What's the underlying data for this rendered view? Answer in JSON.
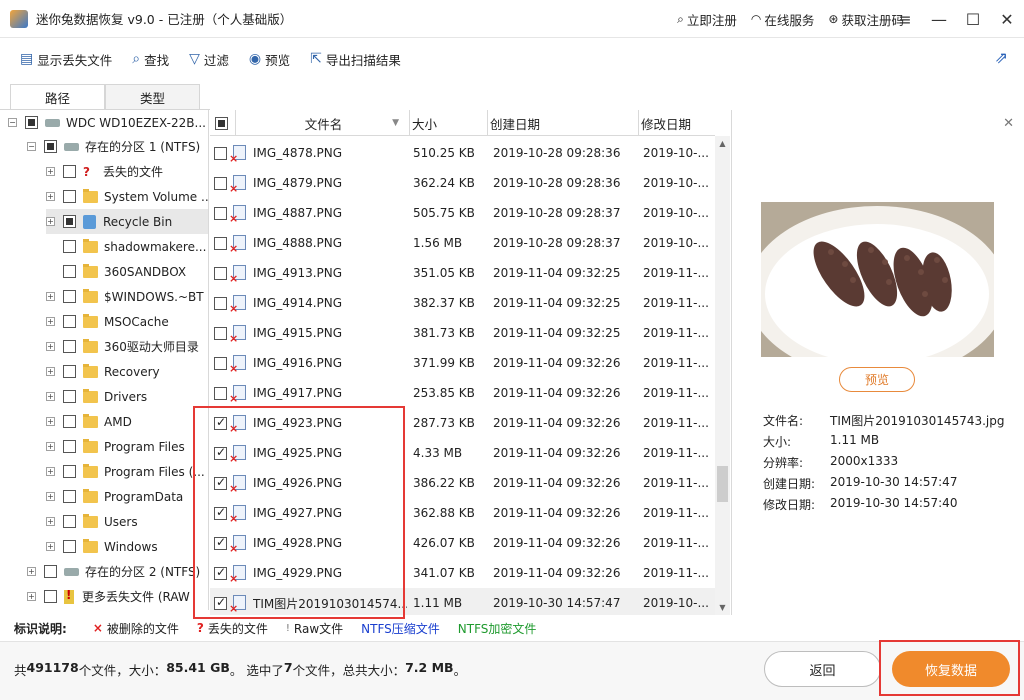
{
  "window": {
    "title": "迷你兔数据恢复 v9.0 - 已注册（个人基础版）",
    "actions": [
      {
        "label": "立即注册",
        "icon": "search-icon"
      },
      {
        "label": "在线服务",
        "icon": "headset-icon"
      },
      {
        "label": "获取注册码",
        "icon": "cart-icon"
      }
    ]
  },
  "toolbar": {
    "show_lost": "显示丢失文件",
    "find": "查找",
    "filter": "过滤",
    "preview": "预览",
    "export": "导出扫描结果"
  },
  "tabs": {
    "path": "路径",
    "type": "类型"
  },
  "tree": {
    "drive": "WDC WD10EZEX-22B...",
    "partition1": "存在的分区 1 (NTFS)",
    "items": [
      "丢失的文件",
      "System Volume ...",
      "Recycle Bin",
      "shadowmakere...",
      "360SANDBOX",
      "$WINDOWS.~BT",
      "MSOCache",
      "360驱动大师目录",
      "Recovery",
      "Drivers",
      "AMD",
      "Program Files",
      "Program Files (...",
      "ProgramData",
      "Users",
      "Windows"
    ],
    "partition2": "存在的分区 2 (NTFS)",
    "more_lost": "更多丢失文件 (RAW"
  },
  "filelist": {
    "headers": {
      "name": "文件名",
      "size": "大小",
      "created": "创建日期",
      "modified": "修改日期"
    },
    "rows": [
      {
        "name": "IMG_4878.PNG",
        "size": "510.25 KB",
        "created": "2019-10-28 09:28:36",
        "modified": "2019-10-...",
        "checked": false
      },
      {
        "name": "IMG_4879.PNG",
        "size": "362.24 KB",
        "created": "2019-10-28 09:28:36",
        "modified": "2019-10-...",
        "checked": false
      },
      {
        "name": "IMG_4887.PNG",
        "size": "505.75 KB",
        "created": "2019-10-28 09:28:37",
        "modified": "2019-10-...",
        "checked": false
      },
      {
        "name": "IMG_4888.PNG",
        "size": "1.56 MB",
        "created": "2019-10-28 09:28:37",
        "modified": "2019-10-...",
        "checked": false
      },
      {
        "name": "IMG_4913.PNG",
        "size": "351.05 KB",
        "created": "2019-11-04 09:32:25",
        "modified": "2019-11-...",
        "checked": false
      },
      {
        "name": "IMG_4914.PNG",
        "size": "382.37 KB",
        "created": "2019-11-04 09:32:25",
        "modified": "2019-11-...",
        "checked": false
      },
      {
        "name": "IMG_4915.PNG",
        "size": "381.73 KB",
        "created": "2019-11-04 09:32:25",
        "modified": "2019-11-...",
        "checked": false
      },
      {
        "name": "IMG_4916.PNG",
        "size": "371.99 KB",
        "created": "2019-11-04 09:32:26",
        "modified": "2019-11-...",
        "checked": false
      },
      {
        "name": "IMG_4917.PNG",
        "size": "253.85 KB",
        "created": "2019-11-04 09:32:26",
        "modified": "2019-11-...",
        "checked": false
      },
      {
        "name": "IMG_4923.PNG",
        "size": "287.73 KB",
        "created": "2019-11-04 09:32:26",
        "modified": "2019-11-...",
        "checked": true
      },
      {
        "name": "IMG_4925.PNG",
        "size": "4.33 MB",
        "created": "2019-11-04 09:32:26",
        "modified": "2019-11-...",
        "checked": true
      },
      {
        "name": "IMG_4926.PNG",
        "size": "386.22 KB",
        "created": "2019-11-04 09:32:26",
        "modified": "2019-11-...",
        "checked": true
      },
      {
        "name": "IMG_4927.PNG",
        "size": "362.88 KB",
        "created": "2019-11-04 09:32:26",
        "modified": "2019-11-...",
        "checked": true
      },
      {
        "name": "IMG_4928.PNG",
        "size": "426.07 KB",
        "created": "2019-11-04 09:32:26",
        "modified": "2019-11-...",
        "checked": true
      },
      {
        "name": "IMG_4929.PNG",
        "size": "341.07 KB",
        "created": "2019-11-04 09:32:26",
        "modified": "2019-11-...",
        "checked": true
      },
      {
        "name": "TIM图片2019103014574...",
        "size": "1.11 MB",
        "created": "2019-10-30 14:57:47",
        "modified": "2019-10-...",
        "checked": true
      }
    ]
  },
  "preview": {
    "button": "预览",
    "info": [
      {
        "label": "文件名:",
        "value": "TIM图片20191030145743.jpg"
      },
      {
        "label": "大小:",
        "value": "1.11 MB"
      },
      {
        "label": "分辨率:",
        "value": "2000x1333"
      },
      {
        "label": "创建日期:",
        "value": "2019-10-30 14:57:47"
      },
      {
        "label": "修改日期:",
        "value": "2019-10-30 14:57:40"
      }
    ]
  },
  "legend": {
    "title": "标识说明:",
    "deleted": "被删除的文件",
    "lost": "丢失的文件",
    "raw": "Raw文件",
    "ntfs_compressed": "NTFS压缩文件",
    "ntfs_encrypted": "NTFS加密文件",
    "colors": {
      "compressed": "#1a3fcf",
      "encrypted": "#1f9a2e"
    }
  },
  "status": {
    "prefix": "共",
    "file_count": "491178",
    "mid1": "个文件，大小：",
    "total_size": "85.41 GB",
    "mid2": "。 选中了",
    "selected_count": "7",
    "mid3": "个文件，总共大小：",
    "selected_size": "7.2 MB",
    "suffix": "。"
  },
  "buttons": {
    "back": "返回",
    "recover": "恢复数据"
  },
  "colors": {
    "accent": "#f08a2c",
    "highlight": "#e53935"
  }
}
